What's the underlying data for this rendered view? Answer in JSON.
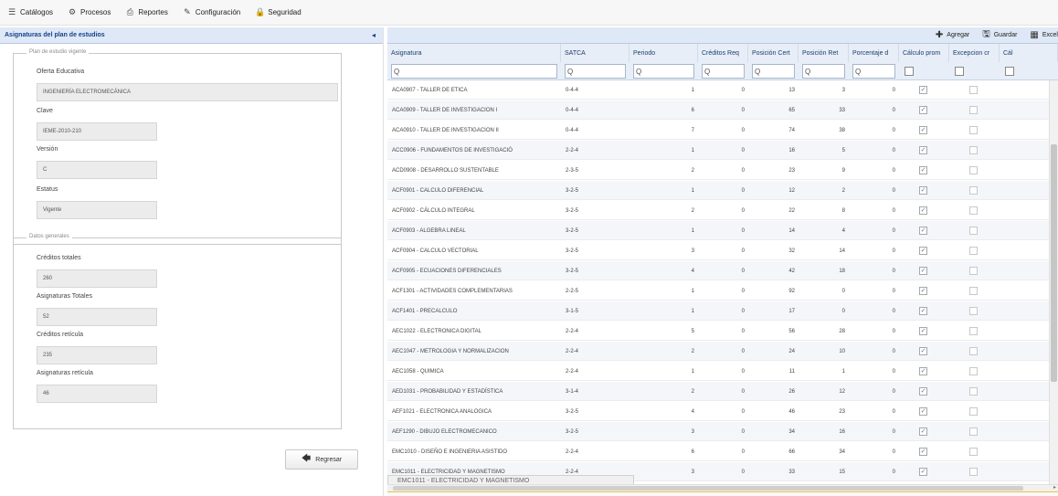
{
  "menu": [
    {
      "icon": "list-icon",
      "glyph": "☰",
      "label": "Catálogos"
    },
    {
      "icon": "gear-icon",
      "glyph": "⚙",
      "label": "Procesos"
    },
    {
      "icon": "print-icon",
      "glyph": "⎙",
      "label": "Reportes"
    },
    {
      "icon": "wrench-icon",
      "glyph": "✎",
      "label": "Configuración"
    },
    {
      "icon": "lock-icon",
      "glyph": "🔒",
      "label": "Seguridad"
    }
  ],
  "left": {
    "title": "Asignaturas del plan de estudios",
    "collapse_glyph": "◂",
    "plan_legend": "Plan de estudio vigente",
    "oferta_label": "Oferta Educativa",
    "oferta_value": "INGENIERÍA ELECTROMECÁNICA",
    "clave_label": "Clave",
    "clave_value": "IEME-2010-210",
    "version_label": "Versión",
    "version_value": "C",
    "estatus_label": "Estatus",
    "estatus_value": "Vigente",
    "datos_legend": "Datos generales",
    "creditos_totales_label": "Créditos totales",
    "creditos_totales_value": "260",
    "asignaturas_totales_label": "Asignaturas Totales",
    "asignaturas_totales_value": "52",
    "creditos_reticula_label": "Créditos retícula",
    "creditos_reticula_value": "235",
    "asignaturas_reticula_label": "Asignaturas retícula",
    "asignaturas_reticula_value": "46",
    "back_label": "Regresar"
  },
  "toolbar": {
    "add_label": "Agregar",
    "save_label": "Guardar",
    "excel_label": "Excel"
  },
  "grid": {
    "columns": [
      "Asignatura",
      "SATCA",
      "Periodo",
      "Créditos Req",
      "Posición Cert",
      "Posición Ret",
      "Porcentaje d",
      "Cálculo prom",
      "Excepcion cr",
      "Cál"
    ],
    "filter_glyph": "Q",
    "check_glyph": "✓",
    "rows": [
      {
        "asignatura": "ACA0907 - TALLER DE ETICA",
        "satca": "0-4-4",
        "periodo": "1",
        "creditos": "0",
        "cert": "13",
        "ret": "3",
        "pct": "0",
        "calc": true,
        "exc": false
      },
      {
        "asignatura": "ACA0909 - TALLER DE INVESTIGACION I",
        "satca": "0-4-4",
        "periodo": "6",
        "creditos": "0",
        "cert": "65",
        "ret": "33",
        "pct": "0",
        "calc": true,
        "exc": false
      },
      {
        "asignatura": "ACA0910 - TALLER DE INVESTIGACION II",
        "satca": "0-4-4",
        "periodo": "7",
        "creditos": "0",
        "cert": "74",
        "ret": "38",
        "pct": "0",
        "calc": true,
        "exc": false
      },
      {
        "asignatura": "ACC0906 - FUNDAMENTOS DE INVESTIGACIÓ",
        "satca": "2-2-4",
        "periodo": "1",
        "creditos": "0",
        "cert": "16",
        "ret": "5",
        "pct": "0",
        "calc": true,
        "exc": false
      },
      {
        "asignatura": "ACD0908 - DESARROLLO SUSTENTABLE",
        "satca": "2-3-5",
        "periodo": "2",
        "creditos": "0",
        "cert": "23",
        "ret": "9",
        "pct": "0",
        "calc": true,
        "exc": false
      },
      {
        "asignatura": "ACF0901 - CALCULO DIFERENCIAL",
        "satca": "3-2-5",
        "periodo": "1",
        "creditos": "0",
        "cert": "12",
        "ret": "2",
        "pct": "0",
        "calc": true,
        "exc": false
      },
      {
        "asignatura": "ACF0902 - CÁLCULO INTEGRAL",
        "satca": "3-2-5",
        "periodo": "2",
        "creditos": "0",
        "cert": "22",
        "ret": "8",
        "pct": "0",
        "calc": true,
        "exc": false
      },
      {
        "asignatura": "ACF0903 - ALGEBRA LINEAL",
        "satca": "3-2-5",
        "periodo": "1",
        "creditos": "0",
        "cert": "14",
        "ret": "4",
        "pct": "0",
        "calc": true,
        "exc": false
      },
      {
        "asignatura": "ACF0904 - CALCULO VECTORIAL",
        "satca": "3-2-5",
        "periodo": "3",
        "creditos": "0",
        "cert": "32",
        "ret": "14",
        "pct": "0",
        "calc": true,
        "exc": false
      },
      {
        "asignatura": "ACF0905 - ECUACIONES DIFERENCIALES",
        "satca": "3-2-5",
        "periodo": "4",
        "creditos": "0",
        "cert": "42",
        "ret": "18",
        "pct": "0",
        "calc": true,
        "exc": false
      },
      {
        "asignatura": "ACF1301 - ACTIVIDADES COMPLEMENTARIAS",
        "satca": "2-2-5",
        "periodo": "1",
        "creditos": "0",
        "cert": "92",
        "ret": "0",
        "pct": "0",
        "calc": true,
        "exc": false
      },
      {
        "asignatura": "ACF1401 - PRECALCULO",
        "satca": "3-1-5",
        "periodo": "1",
        "creditos": "0",
        "cert": "17",
        "ret": "0",
        "pct": "0",
        "calc": true,
        "exc": false
      },
      {
        "asignatura": "AEC1022 - ELECTRONICA DIGITAL",
        "satca": "2-2-4",
        "periodo": "5",
        "creditos": "0",
        "cert": "56",
        "ret": "28",
        "pct": "0",
        "calc": true,
        "exc": false
      },
      {
        "asignatura": "AEC1047 - METROLOGIA Y NORMALIZACION",
        "satca": "2-2-4",
        "periodo": "2",
        "creditos": "0",
        "cert": "24",
        "ret": "10",
        "pct": "0",
        "calc": true,
        "exc": false
      },
      {
        "asignatura": "AEC1058 - QUIMICA",
        "satca": "2-2-4",
        "periodo": "1",
        "creditos": "0",
        "cert": "11",
        "ret": "1",
        "pct": "0",
        "calc": true,
        "exc": false
      },
      {
        "asignatura": "AED1031 - PROBABILIDAD Y ESTADÍSTICA",
        "satca": "3-1-4",
        "periodo": "2",
        "creditos": "0",
        "cert": "26",
        "ret": "12",
        "pct": "0",
        "calc": true,
        "exc": false
      },
      {
        "asignatura": "AEF1021 - ELECTRONICA ANALOGICA",
        "satca": "3-2-5",
        "periodo": "4",
        "creditos": "0",
        "cert": "46",
        "ret": "23",
        "pct": "0",
        "calc": true,
        "exc": false
      },
      {
        "asignatura": "AEF1290 - DIBUJO ELECTROMECANICO",
        "satca": "3-2-5",
        "periodo": "3",
        "creditos": "0",
        "cert": "34",
        "ret": "16",
        "pct": "0",
        "calc": true,
        "exc": false
      },
      {
        "asignatura": "EMC1010 - DISEÑO E INGENIERIA ASISTIDO",
        "satca": "2-2-4",
        "periodo": "6",
        "creditos": "0",
        "cert": "66",
        "ret": "34",
        "pct": "0",
        "calc": true,
        "exc": false
      },
      {
        "asignatura": "EMC1011 - ELECTRICIDAD Y MAGNETISMO",
        "satca": "2-2-4",
        "periodo": "3",
        "creditos": "0",
        "cert": "33",
        "ret": "15",
        "pct": "0",
        "calc": true,
        "exc": false
      }
    ],
    "tooltip": "EMC1011 - ELECTRICIDAD Y MAGNETISMO",
    "hscroll_arrow": "▸"
  }
}
